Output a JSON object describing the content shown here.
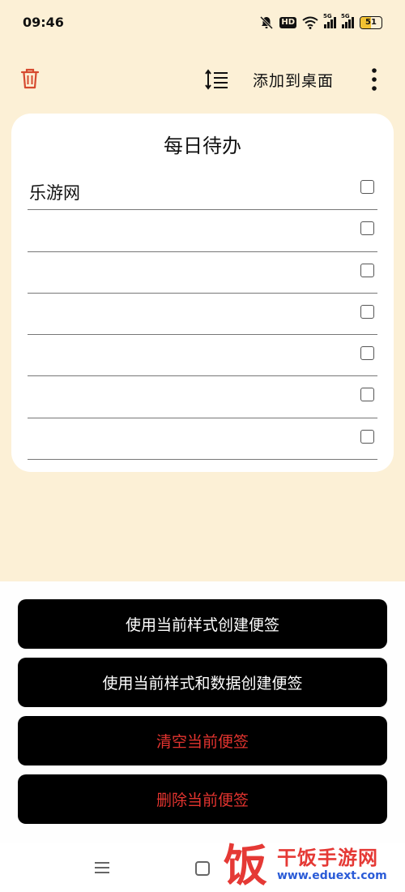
{
  "status": {
    "time": "09:46",
    "hd_label": "HD",
    "sim1_label": "5G",
    "sim2_label": "5G",
    "battery": "51",
    "battery_level": 0.51
  },
  "toolbar": {
    "add_to_desktop": "添加到桌面"
  },
  "note": {
    "title": "每日待办",
    "items": [
      {
        "text": "乐游网",
        "checked": false
      },
      {
        "text": "",
        "checked": false
      },
      {
        "text": "",
        "checked": false
      },
      {
        "text": "",
        "checked": false
      },
      {
        "text": "",
        "checked": false
      },
      {
        "text": "",
        "checked": false
      },
      {
        "text": "",
        "checked": false
      }
    ]
  },
  "sheet": {
    "create_with_style": "使用当前样式创建便签",
    "create_with_style_and_data": "使用当前样式和数据创建便签",
    "clear_current": "清空当前便签",
    "delete_current": "删除当前便签"
  },
  "watermark": {
    "logo_char": "饭",
    "brand": "干饭手游网",
    "url": "www.eduext.com"
  },
  "colors": {
    "background": "#fcf0d6",
    "danger": "#e3342f",
    "battery": "#f2c232"
  }
}
